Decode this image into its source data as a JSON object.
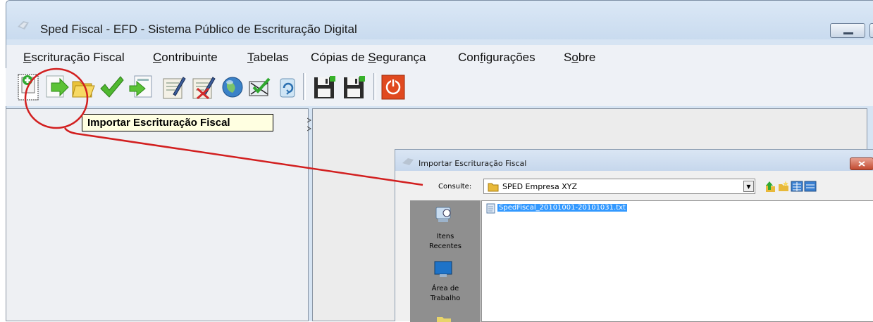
{
  "window": {
    "title": "Sped Fiscal - EFD - Sistema Público de Escrituração Digital"
  },
  "menu": {
    "items": [
      {
        "label": "Escrituração Fiscal",
        "mnemonic": "E"
      },
      {
        "label": "Contribuinte",
        "mnemonic": "C"
      },
      {
        "label": "Tabelas",
        "mnemonic": "T"
      },
      {
        "label": "Cópias de Segurança",
        "mnemonic": "S"
      },
      {
        "label": "Configurações",
        "mnemonic": "f"
      },
      {
        "label": "Sobre",
        "mnemonic": "o"
      }
    ]
  },
  "toolbar": {
    "buttons": [
      {
        "icon": "new-document-icon"
      },
      {
        "icon": "import-arrow-icon"
      },
      {
        "icon": "open-folder-icon"
      },
      {
        "icon": "checkmark-icon"
      },
      {
        "icon": "export-arrow-icon"
      },
      {
        "icon": "sign-document-icon"
      },
      {
        "icon": "delete-signature-icon"
      },
      {
        "icon": "globe-icon"
      },
      {
        "icon": "receipt-icon"
      },
      {
        "icon": "refresh-icon"
      },
      {
        "icon": "save-backup-icon"
      },
      {
        "icon": "restore-backup-icon"
      },
      {
        "icon": "power-icon"
      }
    ]
  },
  "tooltip": {
    "text": "Importar Escrituração Fiscal"
  },
  "dialog": {
    "title": "Importar Escrituração Fiscal",
    "look_in_label": "Consulte:",
    "look_in_value": "SPED Empresa XYZ",
    "places": [
      {
        "label": "Itens Recentes",
        "icon": "recent-items-icon"
      },
      {
        "label": "Área de Trabalho",
        "icon": "desktop-icon"
      }
    ],
    "files": [
      {
        "name": "SpedFiscal_20101001-20101031.txt",
        "selected": true
      }
    ]
  },
  "colors": {
    "annotation": "#d21f1f",
    "window_frame": "#d6e4f3",
    "tooltip_background": "#ffffe1",
    "selection": "#3399ff"
  }
}
